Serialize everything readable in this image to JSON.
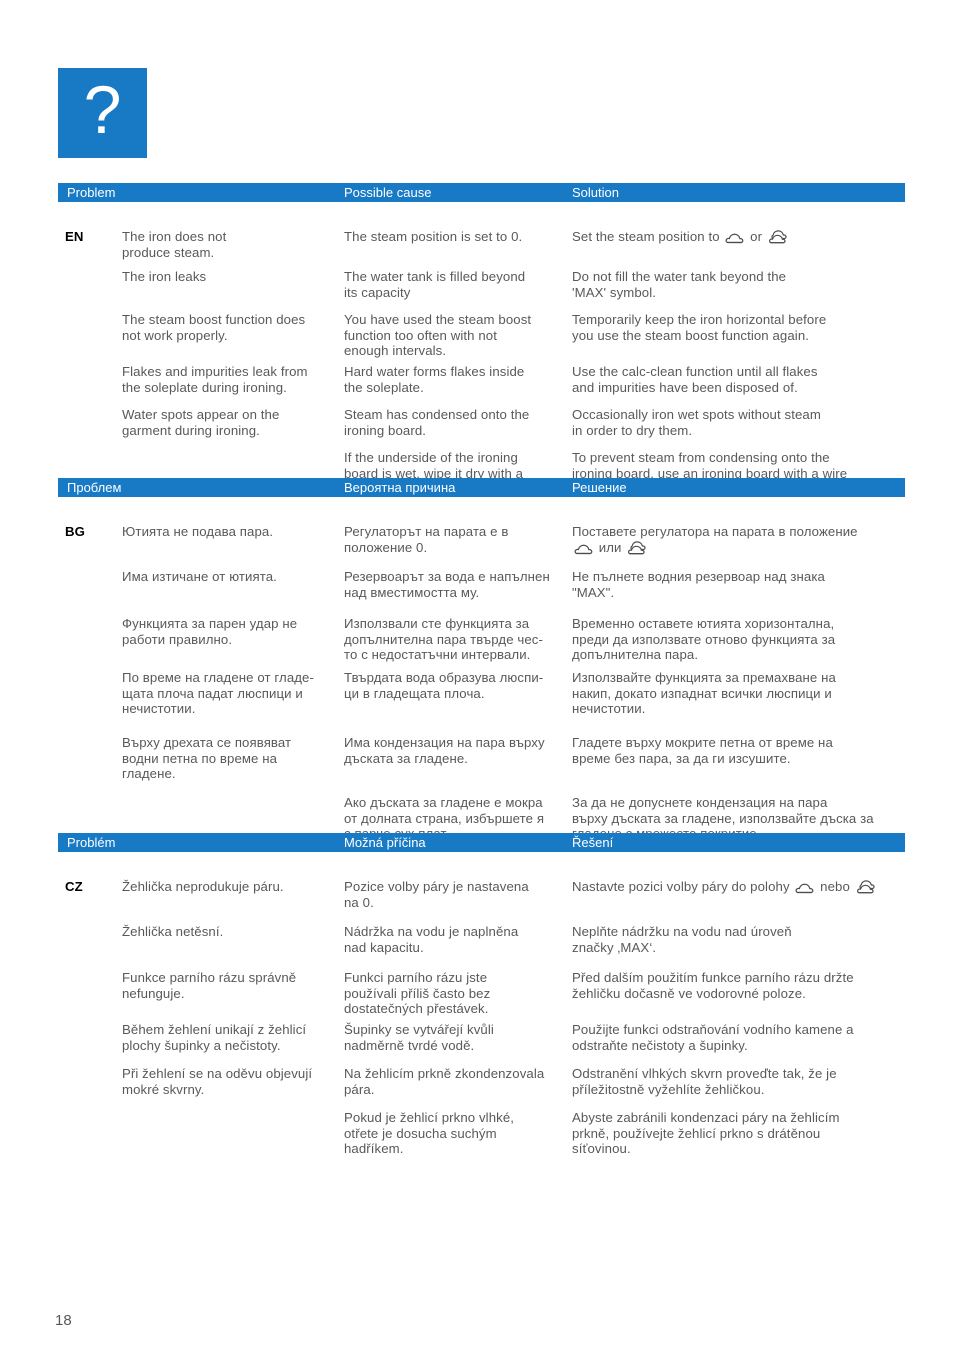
{
  "page": {
    "number": "18",
    "accent_color": "#1879c4",
    "text_color": "#58595b",
    "help_icon_glyph": "?",
    "help_icon_name": "question-mark-icon"
  },
  "icons": {
    "single_steam": "single-cloud-steam-icon",
    "double_steam": "double-cloud-steam-icon"
  },
  "blocks": [
    {
      "lang_code": "EN",
      "headers": {
        "problem": "Problem",
        "cause": "Possible cause",
        "solution": "Solution"
      },
      "rows": [
        {
          "problem": "The iron does not\nproduce steam.",
          "cause": "The steam position is set to 0.",
          "solution_pre": "Set the steam position to ",
          "solution_mid": " or ",
          "solution_post": "",
          "has_icons": true
        },
        {
          "problem": "The iron leaks",
          "cause": "The water tank is filled beyond\nits capacity",
          "solution": "Do not fill the water tank beyond the\n'MAX' symbol.",
          "has_icons": false
        },
        {
          "problem": "The steam boost function does\nnot work properly.",
          "cause": "You have used the steam boost\nfunction too often with not\nenough intervals.",
          "solution": "Temporarily keep the iron horizontal before\nyou use the steam boost function again.",
          "has_icons": false
        },
        {
          "problem": "Flakes and impurities leak from\nthe soleplate during ironing.",
          "cause": "Hard water forms flakes inside\nthe soleplate.",
          "solution": "Use the calc-clean function until all flakes\nand impurities have been disposed of.",
          "has_icons": false
        },
        {
          "problem": "Water spots appear on the\ngarment during ironing.",
          "cause": "Steam has condensed onto the\nironing board.",
          "solution": "Occasionally iron wet spots without steam\nin order to dry them.",
          "has_icons": false
        },
        {
          "problem": "",
          "cause": "If the underside of the ironing\nboard is wet, wipe it dry with a\npiece of dry cloth.",
          "solution": "To prevent steam from condensing onto the\nironing board, use an ironing board with a wire\nmesh top.",
          "has_icons": false
        }
      ]
    },
    {
      "lang_code": "BG",
      "headers": {
        "problem": "Проблем",
        "cause": "Вероятна причина",
        "solution": "Решение"
      },
      "rows": [
        {
          "problem": "Ютията не подава пара.",
          "cause": "Регулаторът на парата е в\nположение 0.",
          "solution_pre": "Поставете регулатора на парата в положение\n",
          "solution_mid": " или ",
          "solution_post": "",
          "has_icons": true
        },
        {
          "problem": "Има изтичане от ютията.",
          "cause": "Резервоарът за вода е напълнен\nнад вместимостта му.",
          "solution": "Не пълнете водния резервоар над знака\n\"MAX\".",
          "has_icons": false
        },
        {
          "problem": "Функцията за парен удар не\nработи правилно.",
          "cause": "Използвали сте функцията за\nдопълнителна пара твърде чес-\nто с недостатъчни интервали.",
          "solution": "Временно оставете ютията хоризонтална,\nпреди да използвате отново функцията за\nдопълнителна пара.",
          "has_icons": false
        },
        {
          "problem": "По време на гладене от гладе-\nщата плоча падат люспици и\nнечистотии.",
          "cause": "Твърдата вода образува люспи-\nци в гладещата плоча.",
          "solution": "Използвайте функцията за премахване на\nнакип, докато изпаднат всички люспици и\nнечистотии.",
          "has_icons": false
        },
        {
          "problem": "Върху дрехата се появяват\nводни петна по време на\nгладене.",
          "cause": "Има кондензация на пара върху\nдъската за гладене.",
          "solution": "Гладете върху мокрите петна от време на\nвреме без пара, за да ги изсушите.",
          "has_icons": false
        },
        {
          "problem": "",
          "cause": "Ако дъската за гладене е мокра\nот долната страна, избършете я\nс парче сух плат.",
          "solution": "За да не допуснете кондензация на пара\nвърху дъската за гладене, използвайте дъска за\nгладене с мрежесто покритие.",
          "has_icons": false
        }
      ]
    },
    {
      "lang_code": "CZ",
      "headers": {
        "problem": "Problém",
        "cause": "Možná příčina",
        "solution": "Řešení"
      },
      "rows": [
        {
          "problem": "Žehlička neprodukuje páru.",
          "cause": "Pozice volby páry je nastavena\nna 0.",
          "solution_pre": "Nastavte pozici volby páry do polohy ",
          "solution_mid": " nebo ",
          "solution_post": "",
          "has_icons": true
        },
        {
          "problem": "Žehlička netěsní.",
          "cause": "Nádržka na vodu je naplněna\nnad kapacitu.",
          "solution": "Neplňte nádržku na vodu nad úroveň\nznačky ‚MAX‘.",
          "has_icons": false
        },
        {
          "problem": "Funkce parního rázu správně\nnefunguje.",
          "cause": "Funkci parního rázu jste\npoužívali příliš často bez\ndostatečných přestávek.",
          "solution": "Před dalším použitím funkce parního rázu držte\nžehličku dočasně ve vodorovné poloze.",
          "has_icons": false
        },
        {
          "problem": "Během žehlení unikají z žehlicí\nplochy šupinky a nečistoty.",
          "cause": "Šupinky se vytvářejí kvůli\nnadměrně tvrdé vodě.",
          "solution": "Použijte funkci odstraňování vodního kamene a\nodstraňte nečistoty a šupinky.",
          "has_icons": false
        },
        {
          "problem": "Při žehlení se na oděvu objevují\nmokré skvrny.",
          "cause": "Na žehlicím prkně zkondenzovala\npára.",
          "solution": "Odstranění vlhkých skvrn proveďte tak, že je\npříležitostně vyžehlíte žehličkou.",
          "has_icons": false
        },
        {
          "problem": "",
          "cause": "Pokud je žehlicí prkno vlhké,\notřete je dosucha suchým\nhadříkem.",
          "solution": "Abyste zabránili kondenzaci páry na žehlicím\nprkně, používejte žehlicí prkno s drátěnou\nsíťovinou.",
          "has_icons": false
        }
      ]
    }
  ]
}
